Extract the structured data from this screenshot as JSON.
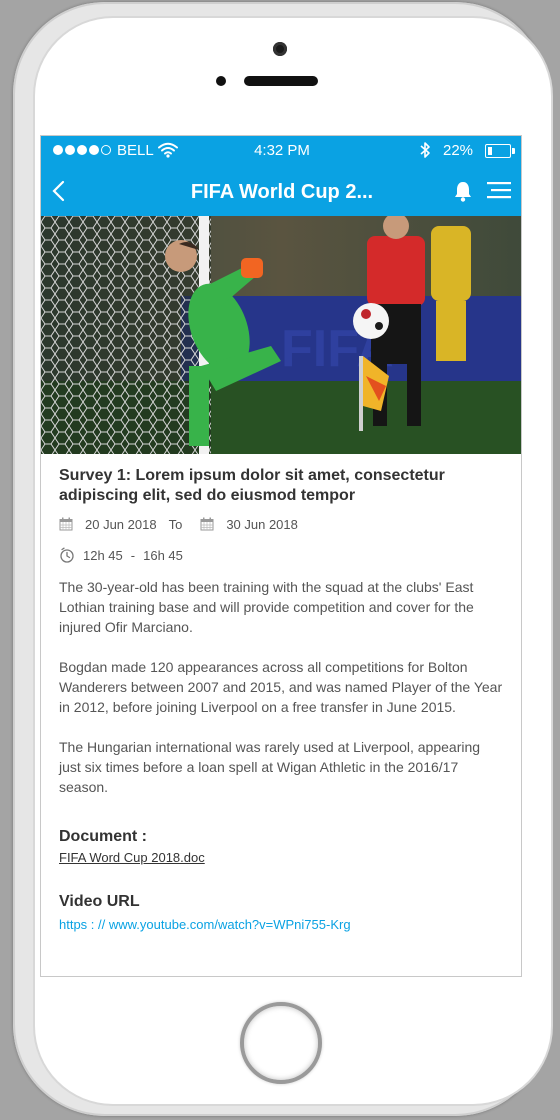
{
  "status_bar": {
    "carrier": "BELL",
    "time": "4:32 PM",
    "battery_percent": "22%",
    "battery_level": 0.22,
    "signal_bars": 4,
    "signal_total": 5
  },
  "nav": {
    "title": "FIFA World Cup 2...",
    "back_icon": "chevron-left-icon",
    "bell_icon": "bell-icon",
    "menu_icon": "hamburger-menu-icon"
  },
  "article": {
    "title": "Survey 1: Lorem ipsum dolor sit amet, consectetur adipiscing elit, sed do eiusmod tempor",
    "start_date": "20 Jun 2018",
    "to_label": "To",
    "end_date": "30 Jun 2018",
    "start_time": "12h 45",
    "time_separator": "-",
    "end_time": "16h 45",
    "paragraphs": [
      "The 30-year-old has been training with the squad at the clubs' East Lothian training base and will provide competition and cover for the injured Ofir Marciano.",
      "Bogdan made 120 appearances across all competitions for Bolton Wanderers between 2007 and 2015, and was named Player of the Year in 2012, before joining Liverpool on a free transfer in June 2015.",
      "The Hungarian international was rarely used at Liverpool, appearing just six times before a loan spell at Wigan Athletic in the 2016/17 season."
    ],
    "document_label": "Document :",
    "document_link": "FIFA Word Cup 2018.doc",
    "video_label": "Video URL",
    "video_link": "https : // www.youtube.com/watch?v=WPni755-Krg"
  },
  "colors": {
    "accent": "#0aa2e3",
    "background": "#a4a4a4"
  }
}
